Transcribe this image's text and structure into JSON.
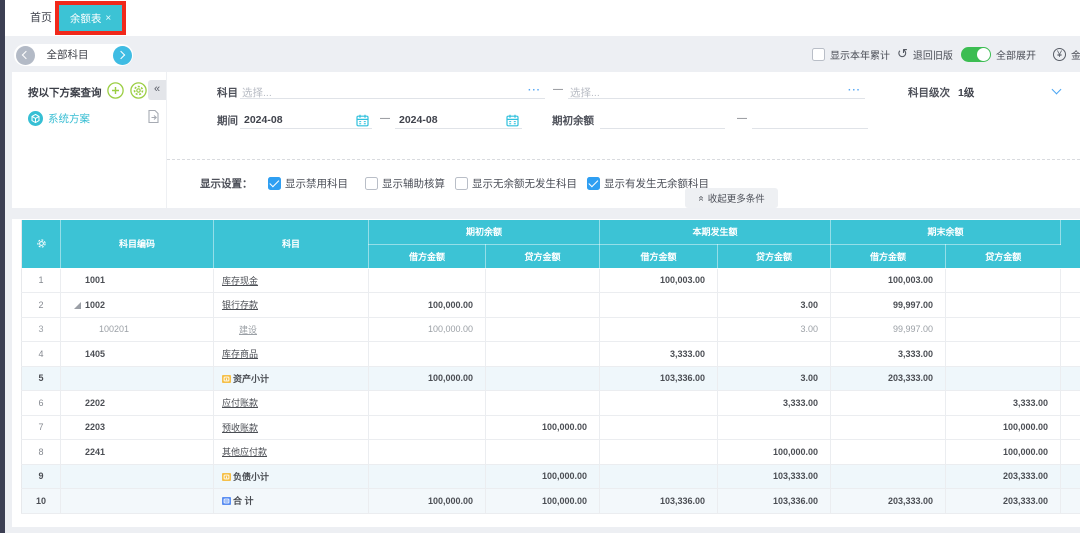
{
  "colors": {
    "accent_cyan": "#3cc3d5",
    "annotation_red": "#f1291b",
    "toggle_green": "#3cbd52",
    "checkbox_blue": "#2f9ff2",
    "link_blue": "#55a7f4",
    "sidebar_green_icon": "#9bce42",
    "scheme_teal": "#39bed3",
    "subtotal_row_bg": "#eff7fb",
    "dark_strip": "#3c3f53",
    "page_bg": "#edeff3"
  },
  "tabs": {
    "home": "首页",
    "active": {
      "label": "余额表",
      "close": "×",
      "annotated": true
    }
  },
  "account_nav": {
    "label": "全部科目"
  },
  "toolbar": {
    "cumulative_checkbox": {
      "label": "显示本年累计",
      "checked": false
    },
    "rollback_button": {
      "label": "退回旧版",
      "icon": "undo-icon"
    },
    "expand_all_toggle": {
      "label": "全部展开",
      "on": true
    },
    "amount_format_button": {
      "label": "金额式",
      "icon": "yuan-circle-icon"
    }
  },
  "sidebar": {
    "title": "按以下方案查询",
    "add_icon": "plus-circle",
    "manage_icon": "gear-circle",
    "collapse_icon": "«",
    "scheme": {
      "label": "系统方案",
      "icon": "cube-circle"
    }
  },
  "filters": {
    "subject": {
      "label": "科目",
      "from_placeholder": "选择...",
      "to_placeholder": "选择...",
      "dash": "—",
      "ellipsis": "···"
    },
    "level": {
      "label": "科目级次",
      "value": "1级"
    },
    "period": {
      "label": "期间",
      "from": "2024-08",
      "to": "2024-08",
      "dash": "—"
    },
    "opening_balance": {
      "label": "期初余额",
      "from": "",
      "to": "",
      "dash": "—"
    },
    "display_settings": {
      "label": "显示设置：",
      "options": [
        {
          "label": "显示禁用科目",
          "checked": true
        },
        {
          "label": "显示辅助核算",
          "checked": false
        },
        {
          "label": "显示无余额无发生科目",
          "checked": false
        },
        {
          "label": "显示有发生无余额科目",
          "checked": true
        }
      ]
    },
    "collapse_more": {
      "label": "收起更多条件"
    }
  },
  "table": {
    "code_header": "科目编码",
    "name_header": "科目",
    "groups": [
      "期初余额",
      "本期发生额",
      "期末余额"
    ],
    "sub_columns": [
      "借方金额",
      "贷方金额"
    ],
    "rows": [
      {
        "no": "1",
        "code": "1001",
        "name": "库存现金",
        "level": 1,
        "cells": [
          "",
          "",
          "100,003.00",
          "",
          "100,003.00",
          ""
        ]
      },
      {
        "no": "2",
        "code": "1002",
        "name": "银行存款",
        "level": 1,
        "expanded": true,
        "cells": [
          "100,000.00",
          "",
          "",
          "3.00",
          "99,997.00",
          ""
        ]
      },
      {
        "no": "3",
        "code": "100201",
        "name": "建设",
        "level": 2,
        "muted": true,
        "cells": [
          "100,000.00",
          "",
          "",
          "3.00",
          "99,997.00",
          ""
        ]
      },
      {
        "no": "4",
        "code": "1405",
        "name": "库存商品",
        "level": 1,
        "cells": [
          "",
          "",
          "3,333.00",
          "",
          "3,333.00",
          ""
        ]
      },
      {
        "no": "5",
        "code": "",
        "name": "资产小计",
        "icon": "folder-yellow-icon",
        "kind": "subtotal",
        "cells": [
          "100,000.00",
          "",
          "103,336.00",
          "3.00",
          "203,333.00",
          ""
        ]
      },
      {
        "no": "6",
        "code": "2202",
        "name": "应付账款",
        "level": 1,
        "cells": [
          "",
          "",
          "",
          "3,333.00",
          "",
          "3,333.00"
        ]
      },
      {
        "no": "7",
        "code": "2203",
        "name": "预收账款",
        "level": 1,
        "cells": [
          "",
          "100,000.00",
          "",
          "",
          "",
          "100,000.00"
        ]
      },
      {
        "no": "8",
        "code": "2241",
        "name": "其他应付款",
        "level": 1,
        "cells": [
          "",
          "",
          "",
          "100,000.00",
          "",
          "100,000.00"
        ]
      },
      {
        "no": "9",
        "code": "",
        "name": "负债小计",
        "icon": "folder-yellow-icon",
        "kind": "subtotal",
        "cells": [
          "",
          "100,000.00",
          "",
          "103,333.00",
          "",
          "203,333.00"
        ]
      },
      {
        "no": "10",
        "code": "",
        "name": "合 计",
        "icon": "calculator-blue-icon",
        "kind": "total",
        "cells": [
          "100,000.00",
          "100,000.00",
          "103,336.00",
          "103,336.00",
          "203,333.00",
          "203,333.00"
        ]
      }
    ]
  }
}
